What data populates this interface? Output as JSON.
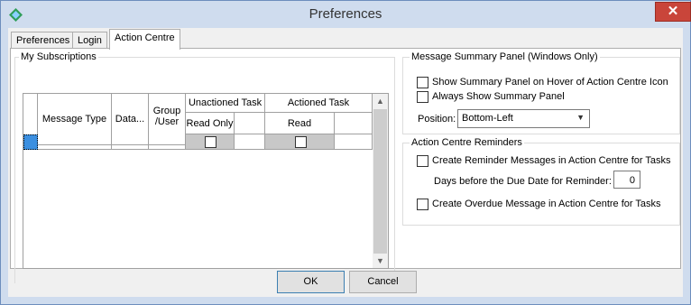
{
  "window": {
    "title": "Preferences",
    "close_glyph": "✕"
  },
  "tabs": [
    {
      "label": "Preferences"
    },
    {
      "label": "Login"
    },
    {
      "label": "Action Centre"
    }
  ],
  "subscriptions": {
    "group_title": "My Subscriptions",
    "columns": {
      "message_type": "Message Type",
      "data": "Data...",
      "group_user_1": "Group",
      "group_user_2": "/User",
      "unactioned": "Unactioned Task",
      "unactioned_read_only": "Read Only",
      "actioned": "Actioned Task",
      "actioned_read": "Read"
    },
    "rows": [
      {
        "message_type": "",
        "data": "",
        "group_user": "",
        "read_only": false,
        "read": false
      }
    ]
  },
  "summary_panel": {
    "group_title": "Message Summary Panel (Windows Only)",
    "show_on_hover": "Show Summary Panel on Hover of Action Centre Icon",
    "always_show": "Always Show Summary Panel",
    "position_label": "Position:",
    "position_value": "Bottom-Left"
  },
  "reminders": {
    "group_title": "Action Centre Reminders",
    "create_reminder": "Create Reminder Messages in Action Centre for Tasks",
    "days_label": "Days before the Due Date for Reminder:",
    "days_value": "0",
    "create_overdue": "Create Overdue Message in Action Centre for Tasks"
  },
  "buttons": {
    "ok": "OK",
    "cancel": "Cancel"
  },
  "colors": {
    "title_bar": "#cfdcee",
    "close_button": "#c9453a",
    "row_indicator": "#3b8fe0",
    "checkbox_cell": "#c8c8c8"
  }
}
